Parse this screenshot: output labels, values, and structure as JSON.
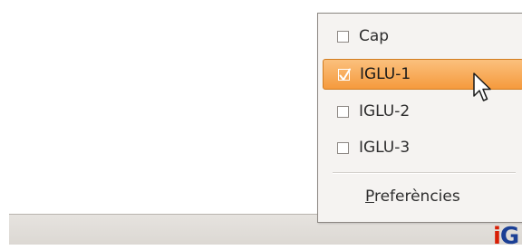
{
  "menu": {
    "items": [
      {
        "label": "Cap",
        "checked": false,
        "highlighted": false
      },
      {
        "label": "IGLU-1",
        "checked": true,
        "highlighted": true
      },
      {
        "label": "IGLU-2",
        "checked": false,
        "highlighted": false
      },
      {
        "label": "IGLU-3",
        "checked": false,
        "highlighted": false
      }
    ],
    "preferences": {
      "mnemonic": "P",
      "rest": "referències"
    }
  },
  "tray": {
    "logo_parts": [
      "i",
      "G"
    ]
  },
  "colors": {
    "highlight": "#f5a04a",
    "highlight_border": "#d17c20",
    "menu_background": "#f5f3f1",
    "taskbar": "#dedad5",
    "logo_red": "#d81e05",
    "logo_blue": "#1b3f95"
  },
  "icons": {
    "checkbox_checked": "check-icon",
    "pointer": "mouse-pointer-icon"
  }
}
